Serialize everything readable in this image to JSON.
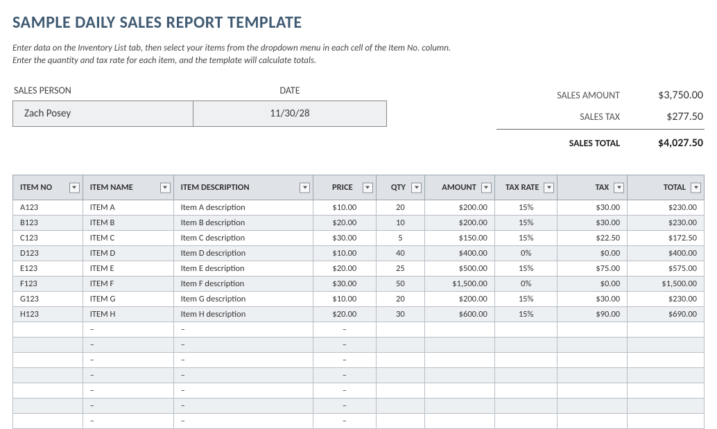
{
  "title": "SAMPLE DAILY SALES REPORT TEMPLATE",
  "instructions_line1": "Enter data on the Inventory List tab, then select your items from the dropdown menu in each cell of the Item No. column.",
  "instructions_line2": "Enter the quantity and tax rate for each item, and the template will calculate totals.",
  "meta": {
    "sales_person_label": "SALES PERSON",
    "date_label": "DATE",
    "sales_person": "Zach Posey",
    "date": "11/30/28"
  },
  "summary": {
    "amount_label": "SALES AMOUNT",
    "amount": "$3,750.00",
    "tax_label": "SALES TAX",
    "tax": "$277.50",
    "total_label": "SALES TOTAL",
    "total": "$4,027.50"
  },
  "headers": {
    "item_no": "ITEM NO",
    "item_name": "ITEM NAME",
    "item_desc": "ITEM DESCRIPTION",
    "price": "PRICE",
    "qty": "QTY",
    "amount": "AMOUNT",
    "tax_rate": "TAX RATE",
    "tax": "TAX",
    "total": "TOTAL"
  },
  "rows": [
    {
      "no": "A123",
      "name": "ITEM A",
      "desc": "Item A description",
      "price": "$10.00",
      "qty": "20",
      "amount": "$200.00",
      "rate": "15%",
      "tax": "$30.00",
      "total": "$230.00"
    },
    {
      "no": "B123",
      "name": "ITEM B",
      "desc": "Item B description",
      "price": "$20.00",
      "qty": "10",
      "amount": "$200.00",
      "rate": "15%",
      "tax": "$30.00",
      "total": "$230.00"
    },
    {
      "no": "C123",
      "name": "ITEM C",
      "desc": "Item C description",
      "price": "$30.00",
      "qty": "5",
      "amount": "$150.00",
      "rate": "15%",
      "tax": "$22.50",
      "total": "$172.50"
    },
    {
      "no": "D123",
      "name": "ITEM D",
      "desc": "Item D description",
      "price": "$10.00",
      "qty": "40",
      "amount": "$400.00",
      "rate": "0%",
      "tax": "$0.00",
      "total": "$400.00"
    },
    {
      "no": "E123",
      "name": "ITEM E",
      "desc": "Item E description",
      "price": "$20.00",
      "qty": "25",
      "amount": "$500.00",
      "rate": "15%",
      "tax": "$75.00",
      "total": "$575.00"
    },
    {
      "no": "F123",
      "name": "ITEM F",
      "desc": "Item F description",
      "price": "$30.00",
      "qty": "50",
      "amount": "$1,500.00",
      "rate": "0%",
      "tax": "$0.00",
      "total": "$1,500.00"
    },
    {
      "no": "G123",
      "name": "ITEM G",
      "desc": "Item G description",
      "price": "$10.00",
      "qty": "20",
      "amount": "$200.00",
      "rate": "15%",
      "tax": "$30.00",
      "total": "$230.00"
    },
    {
      "no": "H123",
      "name": "ITEM H",
      "desc": "Item H description",
      "price": "$20.00",
      "qty": "30",
      "amount": "$600.00",
      "rate": "15%",
      "tax": "$90.00",
      "total": "$690.00"
    },
    {
      "no": "",
      "name": "–",
      "desc": "–",
      "price": "–",
      "qty": "",
      "amount": "",
      "rate": "",
      "tax": "",
      "total": ""
    },
    {
      "no": "",
      "name": "–",
      "desc": "–",
      "price": "–",
      "qty": "",
      "amount": "",
      "rate": "",
      "tax": "",
      "total": ""
    },
    {
      "no": "",
      "name": "–",
      "desc": "–",
      "price": "–",
      "qty": "",
      "amount": "",
      "rate": "",
      "tax": "",
      "total": ""
    },
    {
      "no": "",
      "name": "–",
      "desc": "–",
      "price": "–",
      "qty": "",
      "amount": "",
      "rate": "",
      "tax": "",
      "total": ""
    },
    {
      "no": "",
      "name": "–",
      "desc": "–",
      "price": "–",
      "qty": "",
      "amount": "",
      "rate": "",
      "tax": "",
      "total": ""
    },
    {
      "no": "",
      "name": "–",
      "desc": "–",
      "price": "–",
      "qty": "",
      "amount": "",
      "rate": "",
      "tax": "",
      "total": ""
    },
    {
      "no": "",
      "name": "–",
      "desc": "–",
      "price": "–",
      "qty": "",
      "amount": "",
      "rate": "",
      "tax": "",
      "total": ""
    }
  ]
}
